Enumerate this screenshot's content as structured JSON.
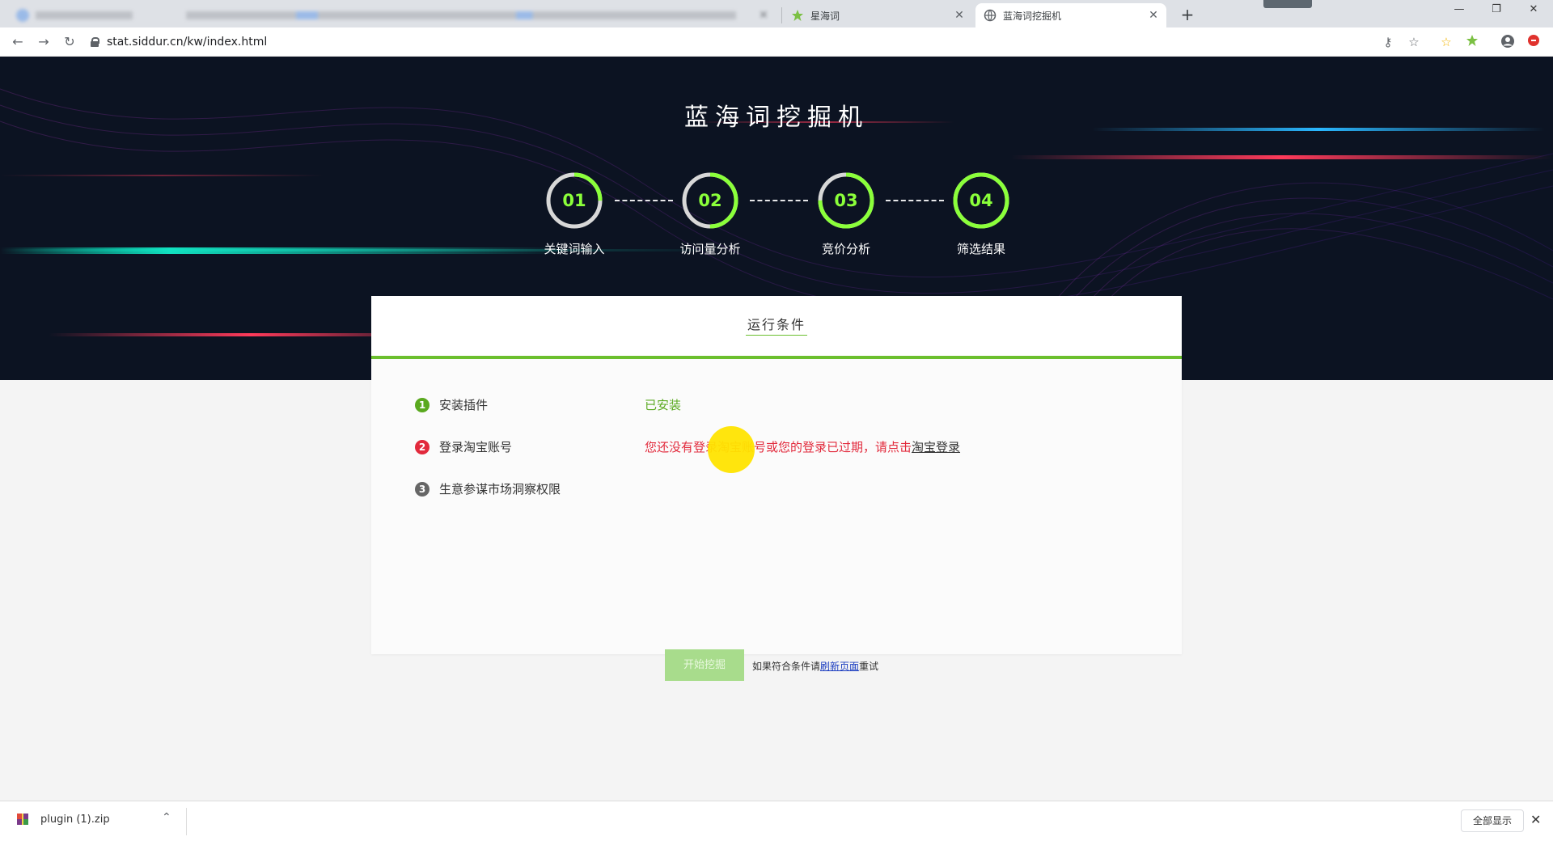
{
  "browser": {
    "tabs": [
      {
        "title": "",
        "blurred": true
      },
      {
        "title": "",
        "blurred": true
      },
      {
        "title": "星海词",
        "favicon": "green-star"
      },
      {
        "title": "蓝海词挖掘机",
        "favicon": "globe",
        "active": true
      }
    ],
    "url": "stat.siddur.cn/kw/index.html"
  },
  "hero": {
    "title": "蓝海词挖掘机",
    "steps": [
      {
        "num": "01",
        "label": "关键词输入",
        "progress": 0.25
      },
      {
        "num": "02",
        "label": "访问量分析",
        "progress": 0.5
      },
      {
        "num": "03",
        "label": "竞价分析",
        "progress": 0.75
      },
      {
        "num": "04",
        "label": "筛选结果",
        "progress": 1.0
      }
    ],
    "colors": {
      "ring_active": "#8bff3a",
      "ring_track": "#d8d8d8"
    }
  },
  "card": {
    "title": "运行条件",
    "conditions": [
      {
        "index": "1",
        "label": "安装插件",
        "status": "已安装",
        "state": "ok",
        "color": "#5aa91f"
      },
      {
        "index": "2",
        "label": "登录淘宝账号",
        "status_text": "您还没有登录淘宝账号或您的登录已过期，请点击",
        "link": "淘宝登录",
        "state": "error",
        "color": "#e22a3c"
      },
      {
        "index": "3",
        "label": "生意参谋市场洞察权限",
        "status": "",
        "state": "pending",
        "color": "#666666"
      }
    ],
    "start_button": "开始挖掘",
    "hint_prefix": "如果符合条件请",
    "hint_link": "刷新页面",
    "hint_suffix": "重试"
  },
  "download": {
    "filename": "plugin (1).zip",
    "show_all": "全部显示"
  }
}
